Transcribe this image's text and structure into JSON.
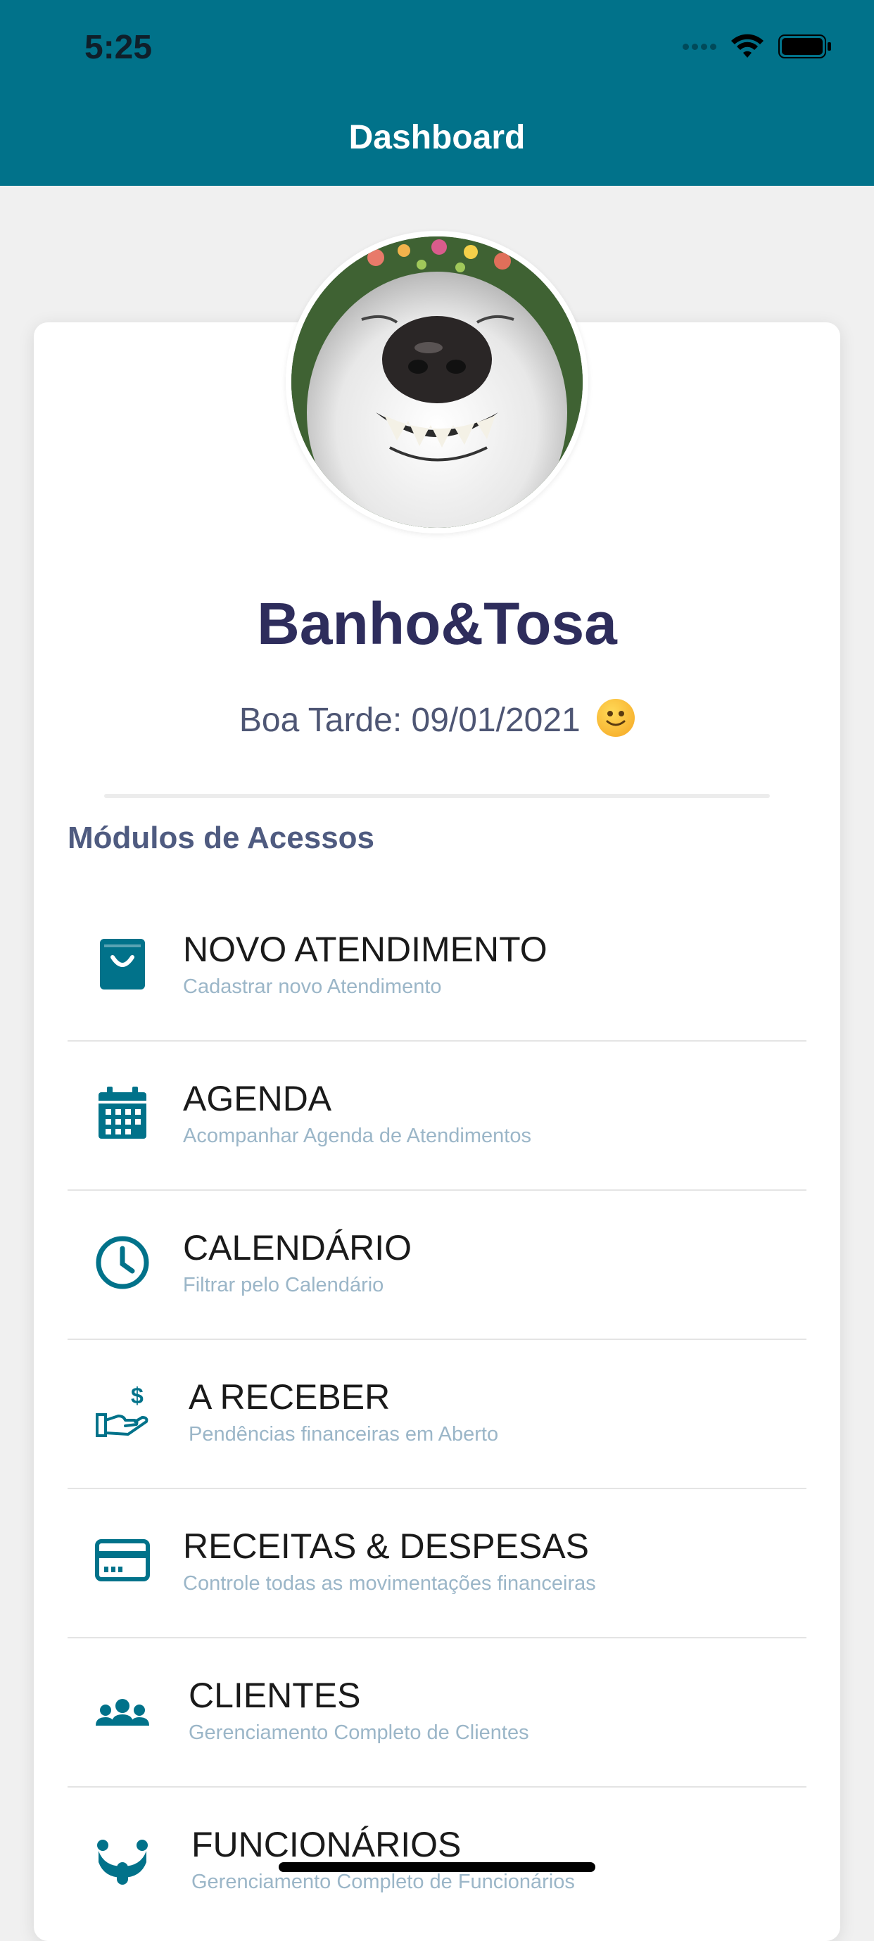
{
  "status_bar": {
    "time": "5:25"
  },
  "nav": {
    "title": "Dashboard"
  },
  "profile": {
    "name": "Banho&Tosa",
    "greeting": "Boa Tarde: 09/01/2021"
  },
  "section": {
    "title": "Módulos de Acessos"
  },
  "menu": [
    {
      "title": "NOVO ATENDIMENTO",
      "subtitle": "Cadastrar novo Atendimento",
      "icon": "shopping-bag-icon"
    },
    {
      "title": "AGENDA",
      "subtitle": "Acompanhar Agenda de Atendimentos",
      "icon": "calendar-icon"
    },
    {
      "title": "CALENDÁRIO",
      "subtitle": "Filtrar pelo Calendário",
      "icon": "clock-icon"
    },
    {
      "title": "A RECEBER",
      "subtitle": "Pendências financeiras em Aberto",
      "icon": "hand-dollar-icon"
    },
    {
      "title": "RECEITAS & DESPESAS",
      "subtitle": "Controle todas as movimentações financeiras",
      "icon": "credit-card-icon"
    },
    {
      "title": "CLIENTES",
      "subtitle": "Gerenciamento Completo de Clientes",
      "icon": "users-icon"
    },
    {
      "title": "FUNCIONÁRIOS",
      "subtitle": "Gerenciamento Completo de Funcionários",
      "icon": "employee-icon"
    }
  ],
  "colors": {
    "primary": "#01728a",
    "title": "#2e2d5c",
    "subtitle": "#9bb6c8"
  }
}
